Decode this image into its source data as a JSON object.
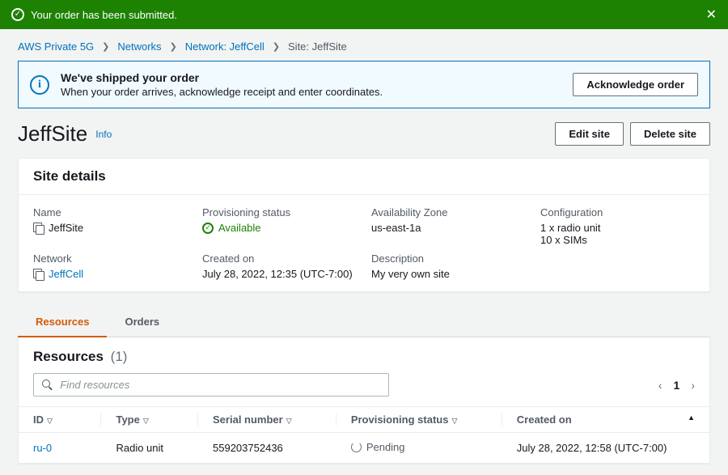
{
  "flash": {
    "message": "Your order has been submitted."
  },
  "breadcrumb": {
    "root": "AWS Private 5G",
    "networks": "Networks",
    "network": "Network: JeffCell",
    "site": "Site: JeffSite"
  },
  "alert": {
    "title": "We've shipped your order",
    "body": "When your order arrives, acknowledge receipt and enter coordinates.",
    "action": "Acknowledge order"
  },
  "header": {
    "title": "JeffSite",
    "info": "Info",
    "edit": "Edit site",
    "delete": "Delete site"
  },
  "details": {
    "panel_title": "Site details",
    "name_label": "Name",
    "name_value": "JeffSite",
    "prov_label": "Provisioning status",
    "prov_value": "Available",
    "az_label": "Availability Zone",
    "az_value": "us-east-1a",
    "config_label": "Configuration",
    "config_line1": "1 x radio unit",
    "config_line2": "10 x SIMs",
    "network_label": "Network",
    "network_value": "JeffCell",
    "created_label": "Created on",
    "created_value": "July 28, 2022, 12:35 (UTC-7:00)",
    "desc_label": "Description",
    "desc_value": "My very own site"
  },
  "tabs": {
    "resources": "Resources",
    "orders": "Orders"
  },
  "resources": {
    "title": "Resources",
    "count": "(1)",
    "search_placeholder": "Find resources",
    "page": "1",
    "columns": {
      "id": "ID",
      "type": "Type",
      "serial": "Serial number",
      "status": "Provisioning status",
      "created": "Created on"
    },
    "rows": [
      {
        "id": "ru-0",
        "type": "Radio unit",
        "serial": "559203752436",
        "status": "Pending",
        "created": "July 28, 2022, 12:58 (UTC-7:00)"
      }
    ]
  }
}
